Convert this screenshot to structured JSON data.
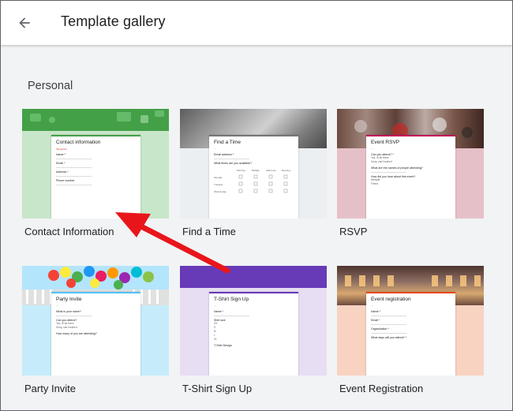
{
  "header": {
    "title": "Template gallery",
    "back_icon": "arrow-back-icon"
  },
  "section": {
    "title": "Personal"
  },
  "templates": [
    {
      "label": "Contact Information",
      "theme": "#4caf50",
      "bg": "#c8e6c9",
      "form_title": "Contact information",
      "questions": [
        "Name *",
        "Email *",
        "Address *",
        "Phone number"
      ]
    },
    {
      "label": "Find a Time",
      "theme": "#9e9e9e",
      "bg": "#eceff1",
      "form_title": "Find a Time",
      "questions": [
        "Email address *",
        "What times are you available?"
      ],
      "grid_cols": [
        "Morning",
        "Midday",
        "Afternoon",
        "Evening"
      ],
      "grid_rows": [
        "Monday",
        "Tuesday",
        "Wednesday"
      ]
    },
    {
      "label": "RSVP",
      "theme": "#c2185b",
      "bg": "#e6c0c8",
      "form_title": "Event RSVP",
      "questions": [
        "Can you attend? *",
        "What are the names of people attending?",
        "How did you hear about this event?"
      ],
      "options": [
        "Yes, I'll be there",
        "Sorry, can't make it",
        "Website",
        "Friend"
      ]
    },
    {
      "label": "Party Invite",
      "theme": "#4fc3f7",
      "bg": "#c6ecfb",
      "form_title": "Party Invite",
      "questions": [
        "What is your name?",
        "Can you attend?",
        "How many of you are attending?"
      ],
      "options": [
        "Yes, I'll be there",
        "Sorry, can't make it"
      ]
    },
    {
      "label": "T-Shirt Sign Up",
      "theme": "#673ab7",
      "bg": "#e7def3",
      "form_title": "T-Shirt Sign Up",
      "questions": [
        "Name *",
        "Shirt size",
        "T-Shirt Design"
      ],
      "options": [
        "XS",
        "S",
        "M",
        "L",
        "XL"
      ]
    },
    {
      "label": "Event Registration",
      "theme": "#e64a19",
      "bg": "#f9d3c2",
      "form_title": "Event registration",
      "questions": [
        "Name *",
        "Email *",
        "Organization *",
        "What days will you attend? *"
      ]
    }
  ]
}
